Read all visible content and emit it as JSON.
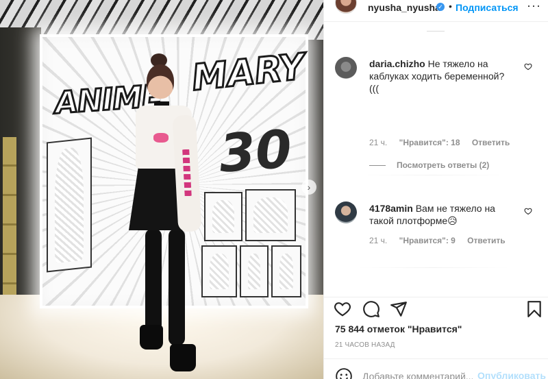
{
  "header": {
    "username": "nyusha_nyusha",
    "separator": "•",
    "follow_label": "Подписаться",
    "more_icon": "more-horizontal-icon"
  },
  "comments": [
    {
      "username": "daria.chizho",
      "text": "Не тяжело на каблуках ходить беременной? (((",
      "age": "21 ч.",
      "likes_label": "\"Нравится\": 18",
      "reply_label": "Ответить",
      "view_replies_label": "Посмотреть ответы (2)"
    },
    {
      "username": "4178amin",
      "text": "Вам не тяжело на такой плотформе😥",
      "age": "21 ч.",
      "likes_label": "\"Нравится\": 9",
      "reply_label": "Ответить"
    }
  ],
  "post": {
    "likes_text": "75 844 отметок \"Нравится\"",
    "time_text": "21 часов назад"
  },
  "add_comment": {
    "placeholder": "Добавьте комментарий...",
    "publish_label": "Опубликовать"
  },
  "photo": {
    "banner_word_1": "ANIME",
    "banner_word_2": "MARY",
    "banner_number": "30",
    "next_icon": "chevron-right-icon"
  },
  "colors": {
    "accent": "#0095f6",
    "publish_disabled": "#b2dffc",
    "secondary_text": "#8e8e8e",
    "primary_text": "#262626",
    "border": "#efefef"
  },
  "icons": [
    "verified-badge-icon",
    "heart-icon",
    "comment-icon",
    "share-icon",
    "bookmark-icon",
    "emoji-icon"
  ]
}
